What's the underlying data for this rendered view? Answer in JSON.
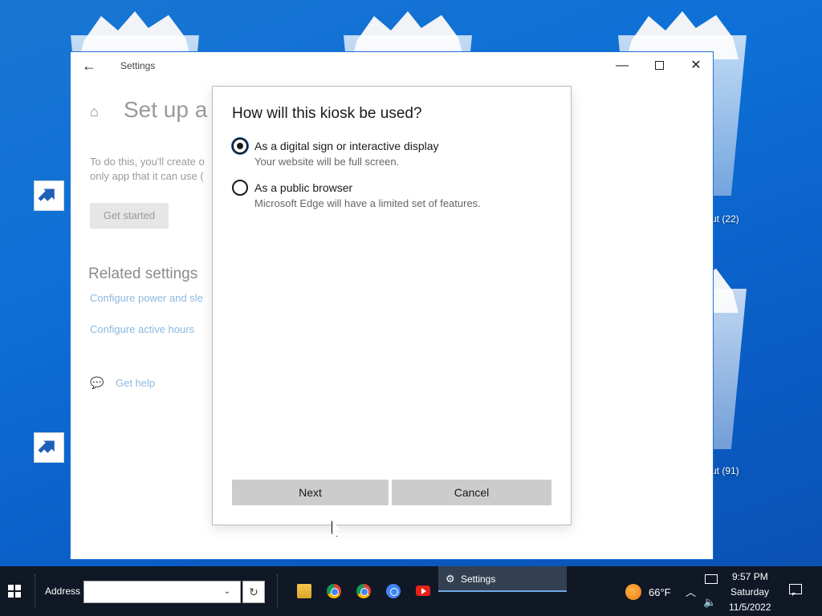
{
  "desktop": {
    "bin_label_1": "ut (22)",
    "bin_label_2": "ut (91)"
  },
  "settings_window": {
    "title": "Settings",
    "page_heading": "Set up a k",
    "description_line1": "To do this, you'll create o",
    "description_line2": "only app that it can use (",
    "get_started": "Get started",
    "related_title": "Related settings",
    "link_power": "Configure power and sle",
    "link_hours": "Configure active hours",
    "help_link": "Get help"
  },
  "dialog": {
    "title": "How will this kiosk be used?",
    "options": [
      {
        "label": "As a digital sign or interactive display",
        "desc": "Your website will be full screen.",
        "checked": true
      },
      {
        "label": "As a public browser",
        "desc": "Microsoft Edge will have a limited set of features.",
        "checked": false
      }
    ],
    "next_label": "Next",
    "cancel_label": "Cancel"
  },
  "taskbar": {
    "address_label": "Address",
    "address_value": "",
    "pinned_icons": [
      "file-explorer-icon",
      "chrome-icon",
      "chrome-canary-icon",
      "chromium-icon",
      "youtube-icon"
    ],
    "active_task": "Settings",
    "weather": "66°F",
    "time": "9:57 PM",
    "day": "Saturday",
    "date": "11/5/2022"
  },
  "colors": {
    "desktop": "#0d6fd6",
    "taskbar": "#101826",
    "button": "#cccccc",
    "link": "#8bb8e0"
  }
}
